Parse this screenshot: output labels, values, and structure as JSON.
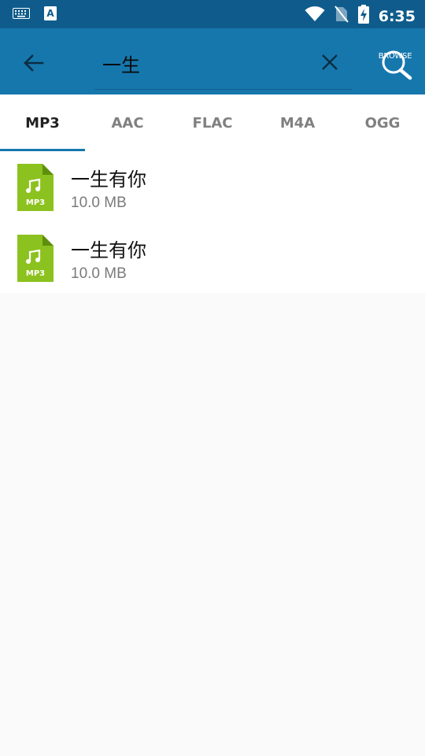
{
  "status_bar": {
    "time": "6:35",
    "icons": [
      "keyboard-icon",
      "a-icon",
      "wifi-icon",
      "no-sim-icon",
      "battery-charging-icon"
    ]
  },
  "app_bar": {
    "search": {
      "value": "一生",
      "placeholder": ""
    },
    "browse_label": "BROWSE",
    "icons": [
      "back-arrow-icon",
      "close-icon",
      "browse-search-icon"
    ]
  },
  "tabs": [
    {
      "label": "MP3",
      "active": true
    },
    {
      "label": "AAC",
      "active": false
    },
    {
      "label": "FLAC",
      "active": false
    },
    {
      "label": "M4A",
      "active": false
    },
    {
      "label": "OGG",
      "active": false
    }
  ],
  "results": [
    {
      "title": "一生有你",
      "size": "10.0 MB",
      "badge": "MP3"
    },
    {
      "title": "一生有你",
      "size": "10.0 MB",
      "badge": "MP3"
    }
  ],
  "colors": {
    "status_bar": "#0f5c8c",
    "app_bar": "#1677ad",
    "accent": "#1677ad",
    "file_icon": "#8cc21f",
    "background": "#fafafa"
  }
}
